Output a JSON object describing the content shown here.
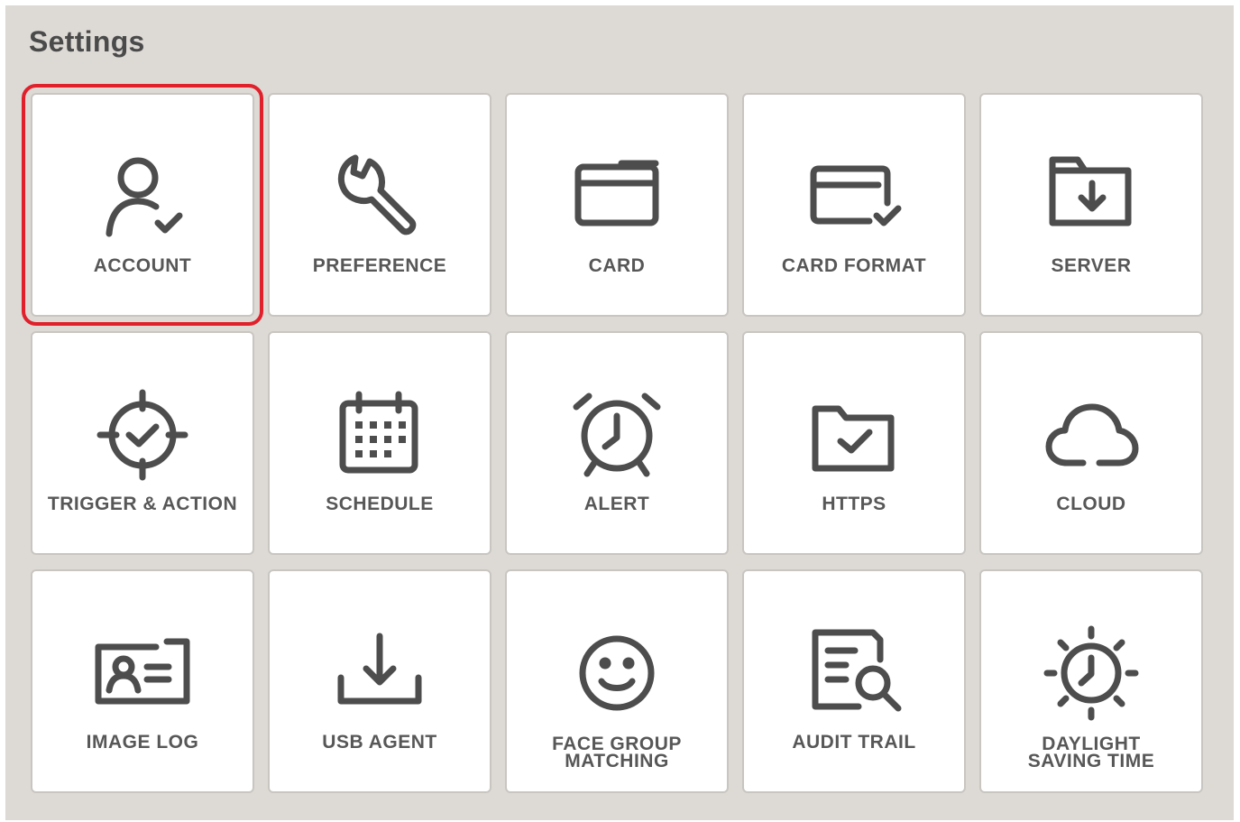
{
  "page": {
    "title": "Settings",
    "accent": "#e0202a",
    "icon_color": "#4d4d4d"
  },
  "tiles": [
    {
      "id": "account",
      "label": "ACCOUNT",
      "icon": "user-check-icon",
      "selected": true
    },
    {
      "id": "preference",
      "label": "PREFERENCE",
      "icon": "wrench-icon"
    },
    {
      "id": "card",
      "label": "CARD",
      "icon": "card-icon"
    },
    {
      "id": "card-format",
      "label": "CARD FORMAT",
      "icon": "card-check-icon"
    },
    {
      "id": "server",
      "label": "SERVER",
      "icon": "folder-download-icon"
    },
    {
      "id": "trigger-action",
      "label": "TRIGGER & ACTION",
      "icon": "target-check-icon"
    },
    {
      "id": "schedule",
      "label": "SCHEDULE",
      "icon": "calendar-icon"
    },
    {
      "id": "alert",
      "label": "ALERT",
      "icon": "alarm-clock-icon"
    },
    {
      "id": "https",
      "label": "HTTPS",
      "icon": "folder-check-icon"
    },
    {
      "id": "cloud",
      "label": "CLOUD",
      "icon": "cloud-icon"
    },
    {
      "id": "image-log",
      "label": "IMAGE LOG",
      "icon": "id-card-icon"
    },
    {
      "id": "usb-agent",
      "label": "USB AGENT",
      "icon": "download-tray-icon"
    },
    {
      "id": "face-group-matching",
      "label_lines": [
        "FACE GROUP",
        "MATCHING"
      ],
      "icon": "smiley-face-icon"
    },
    {
      "id": "audit-trail",
      "label": "AUDIT TRAIL",
      "icon": "document-search-icon"
    },
    {
      "id": "daylight-saving-time",
      "label_lines": [
        "DAYLIGHT",
        "SAVING TIME"
      ],
      "icon": "sun-clock-icon"
    }
  ]
}
